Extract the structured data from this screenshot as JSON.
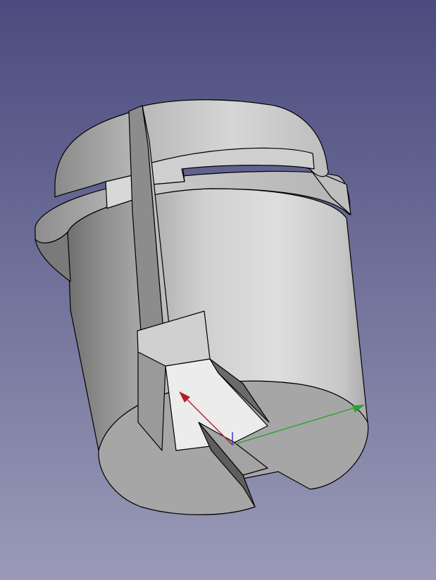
{
  "view": {
    "background_top": "#4b4b7f",
    "background_bottom": "#9a9ab8"
  },
  "model": {
    "part_icon": "cylindrical-sleeve-part-icon",
    "edge_color": "#000000",
    "face_light": "#d2d2d2",
    "face_mid": "#a9a9a9",
    "face_dark": "#6e6e6e"
  },
  "axes": {
    "icon": "coordinate-axes-icon",
    "x_color": "#2ea02e",
    "y_color": "#b0202a",
    "z_color": "#2a2ab8"
  }
}
